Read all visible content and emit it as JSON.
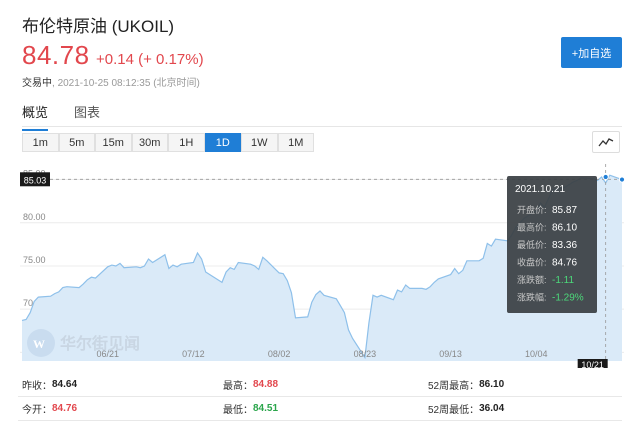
{
  "header": {
    "title": "布伦特原油 (UKOIL)",
    "price": "84.78",
    "change": "+0.14 (+ 0.17%)",
    "status": "交易中",
    "timestamp": "2021-10-25 08:12:35 (北京时间)",
    "add_label": "+加自选"
  },
  "tabs": [
    "概览",
    "图表"
  ],
  "ranges": [
    "1m",
    "5m",
    "15m",
    "30m",
    "1H",
    "1D",
    "1W",
    "1M"
  ],
  "active_range": "1D",
  "stats": {
    "prev_close_label": "昨收：",
    "prev_close": "84.64",
    "high_label": "最高：",
    "high": "84.88",
    "high52_label": "52周最高：",
    "high52": "86.10",
    "open_label": "今开：",
    "open": "84.76",
    "low_label": "最低：",
    "low": "84.51",
    "low52_label": "52周最低：",
    "low52": "36.04"
  },
  "watermark": "华尔街见闻",
  "colors": {
    "accent": "#1f7ed6",
    "up": "#e2474d",
    "down": "#2aa54b",
    "area": "#daeaf8",
    "line": "#8ec0ea"
  },
  "chart_data": {
    "type": "area",
    "x_ticks": [
      "06/21",
      "07/12",
      "08/02",
      "08/23",
      "09/13",
      "10/04"
    ],
    "y_ticks": [
      "85.00",
      "80.00",
      "75.00",
      "70.00",
      "65.00"
    ],
    "ylim": [
      64.0,
      86.8
    ],
    "last_price_label": "85.03",
    "last_date_label": "10/21",
    "x": [
      "2021-05-31",
      "2021-06-01",
      "2021-06-02",
      "2021-06-03",
      "2021-06-04",
      "2021-06-07",
      "2021-06-08",
      "2021-06-09",
      "2021-06-10",
      "2021-06-11",
      "2021-06-14",
      "2021-06-15",
      "2021-06-16",
      "2021-06-17",
      "2021-06-18",
      "2021-06-21",
      "2021-06-22",
      "2021-06-23",
      "2021-06-24",
      "2021-06-25",
      "2021-06-28",
      "2021-06-29",
      "2021-06-30",
      "2021-07-01",
      "2021-07-02",
      "2021-07-05",
      "2021-07-06",
      "2021-07-07",
      "2021-07-08",
      "2021-07-09",
      "2021-07-12",
      "2021-07-13",
      "2021-07-14",
      "2021-07-15",
      "2021-07-16",
      "2021-07-19",
      "2021-07-20",
      "2021-07-21",
      "2021-07-22",
      "2021-07-23",
      "2021-07-26",
      "2021-07-27",
      "2021-07-28",
      "2021-07-29",
      "2021-07-30",
      "2021-08-02",
      "2021-08-03",
      "2021-08-04",
      "2021-08-05",
      "2021-08-06",
      "2021-08-09",
      "2021-08-10",
      "2021-08-11",
      "2021-08-12",
      "2021-08-13",
      "2021-08-16",
      "2021-08-17",
      "2021-08-18",
      "2021-08-19",
      "2021-08-20",
      "2021-08-23",
      "2021-08-24",
      "2021-08-25",
      "2021-08-26",
      "2021-08-27",
      "2021-08-30",
      "2021-08-31",
      "2021-09-01",
      "2021-09-02",
      "2021-09-03",
      "2021-09-06",
      "2021-09-07",
      "2021-09-08",
      "2021-09-09",
      "2021-09-10",
      "2021-09-13",
      "2021-09-14",
      "2021-09-15",
      "2021-09-16",
      "2021-09-17",
      "2021-09-20",
      "2021-09-21",
      "2021-09-22",
      "2021-09-23",
      "2021-09-24",
      "2021-09-27",
      "2021-09-28",
      "2021-09-29",
      "2021-09-30",
      "2021-10-01",
      "2021-10-04",
      "2021-10-05",
      "2021-10-06",
      "2021-10-07",
      "2021-10-08",
      "2021-10-11",
      "2021-10-12",
      "2021-10-13",
      "2021-10-14",
      "2021-10-15",
      "2021-10-18",
      "2021-10-19",
      "2021-10-20",
      "2021-10-21",
      "2021-10-22",
      "2021-10-25"
    ],
    "values": [
      68.7,
      68.8,
      69.6,
      70.9,
      71.4,
      71.5,
      71.8,
      72.0,
      72.5,
      72.6,
      72.5,
      72.9,
      73.4,
      73.7,
      73.6,
      74.9,
      75.1,
      75.0,
      75.3,
      74.8,
      74.9,
      74.8,
      75.0,
      75.8,
      75.4,
      76.3,
      74.7,
      75.1,
      74.9,
      75.2,
      75.4,
      76.5,
      75.8,
      74.3,
      74.0,
      73.1,
      74.3,
      74.8,
      74.6,
      75.4,
      75.2,
      75.0,
      74.6,
      76.0,
      75.6,
      74.2,
      74.1,
      73.3,
      71.9,
      69.0,
      69.1,
      70.8,
      71.7,
      72.1,
      71.6,
      71.2,
      70.4,
      69.6,
      67.6,
      66.6,
      64.4,
      68.4,
      71.6,
      71.4,
      71.6,
      71.1,
      72.2,
      72.0,
      72.8,
      72.4,
      72.4,
      72.3,
      72.6,
      73.1,
      73.5,
      74.0,
      74.7,
      74.1,
      74.5,
      75.6,
      75.6,
      75.9,
      77.6,
      77.3,
      78.1,
      77.9,
      78.6,
      79.5,
      80.0,
      80.5,
      81.4,
      82.3,
      81.8,
      82.8,
      83.8,
      84.1,
      84.4,
      84.7,
      84.9,
      85.2,
      85.1,
      84.9,
      85.3,
      84.6,
      85.5,
      85.0
    ],
    "tooltip": {
      "date": "2021.10.21",
      "rows": [
        {
          "label": "开盘价:",
          "value": "85.87",
          "tone": "white"
        },
        {
          "label": "最高价:",
          "value": "86.10",
          "tone": "white"
        },
        {
          "label": "最低价:",
          "value": "83.36",
          "tone": "white"
        },
        {
          "label": "收盘价:",
          "value": "84.76",
          "tone": "white"
        },
        {
          "label": "涨跌额:",
          "value": "-1.11",
          "tone": "green"
        },
        {
          "label": "涨跌幅:",
          "value": "-1.29%",
          "tone": "green"
        }
      ]
    }
  }
}
